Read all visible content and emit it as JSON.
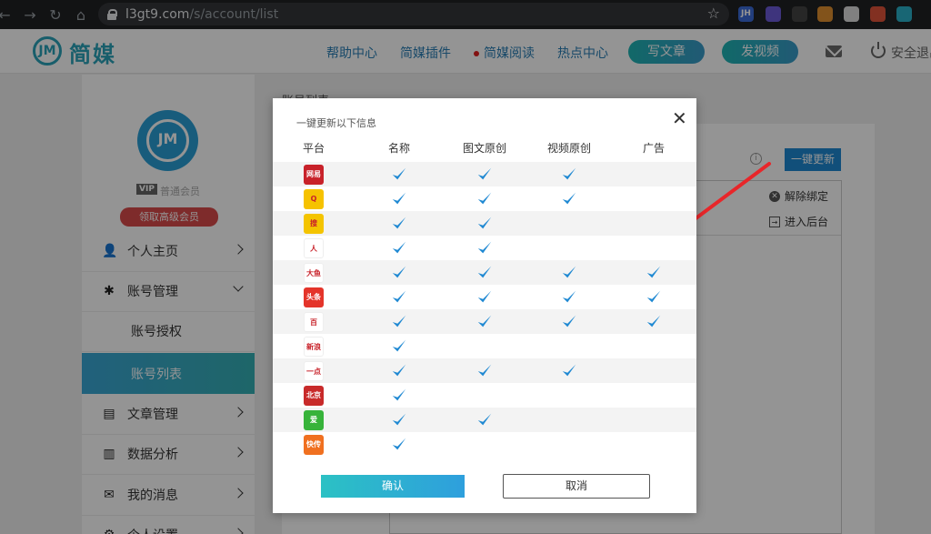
{
  "browser": {
    "url_host": "l3gt9.com",
    "url_path": "/s/account/list",
    "extensions": [
      {
        "label": "JH",
        "color": "#3b6bd8"
      },
      {
        "label": "",
        "color": "#6b5bd8"
      },
      {
        "label": "",
        "color": "#444"
      },
      {
        "label": "",
        "color": "#e09030"
      },
      {
        "label": "",
        "color": "#ddd"
      },
      {
        "label": "",
        "color": "#e0533a"
      },
      {
        "label": "",
        "color": "#2ab0c8"
      }
    ]
  },
  "app": {
    "logo_text": "简媒",
    "nav": [
      "帮助中心",
      "简媒插件",
      "简媒阅读",
      "热点中心"
    ],
    "write_article": "写文章",
    "post_video": "发视频",
    "logout": "安全退出"
  },
  "sidebar": {
    "vip_badge": "VIP",
    "member_level": "普通会员",
    "upgrade_label": "领取高级会员",
    "items": [
      {
        "label": "个人主页",
        "icon": "user-icon",
        "glyph": "👤"
      },
      {
        "label": "账号管理",
        "icon": "asterisk-icon",
        "glyph": "✱"
      },
      {
        "label": "账号授权",
        "icon": "",
        "glyph": ""
      },
      {
        "label": "账号列表",
        "icon": "",
        "glyph": ""
      },
      {
        "label": "文章管理",
        "icon": "document-icon",
        "glyph": "▤"
      },
      {
        "label": "数据分析",
        "icon": "bar-chart-icon",
        "glyph": "▥"
      },
      {
        "label": "我的消息",
        "icon": "message-icon",
        "glyph": "✉"
      },
      {
        "label": "个人设置",
        "icon": "gear-icon",
        "glyph": "⚙"
      }
    ]
  },
  "main": {
    "breadcrumb": "账号列表",
    "update_button": "一键更新",
    "unbind": "解除绑定",
    "enter_backend": "进入后台"
  },
  "modal": {
    "title": "一键更新以下信息",
    "columns": [
      "平台",
      "名称",
      "图文原创",
      "视频原创",
      "广告"
    ],
    "rows": [
      {
        "platform": "wangyi",
        "label": "网易",
        "color": "#c8222a",
        "checks": [
          true,
          true,
          true,
          false
        ]
      },
      {
        "platform": "qq",
        "label": "Q",
        "color": "#f6c200",
        "checks": [
          true,
          true,
          true,
          false
        ]
      },
      {
        "platform": "sohu",
        "label": "搜",
        "color": "#f4c400",
        "checks": [
          true,
          true,
          false,
          false
        ]
      },
      {
        "platform": "renmin",
        "label": "人",
        "color": "#ffffff",
        "checks": [
          true,
          true,
          false,
          false
        ]
      },
      {
        "platform": "dayu",
        "label": "大鱼号",
        "color": "#ffffff",
        "checks": [
          true,
          true,
          true,
          true
        ]
      },
      {
        "platform": "toutiao",
        "label": "头条",
        "color": "#e4342a",
        "checks": [
          true,
          true,
          true,
          true
        ]
      },
      {
        "platform": "baijia",
        "label": "百",
        "color": "#ffffff",
        "checks": [
          true,
          true,
          true,
          true
        ]
      },
      {
        "platform": "xinlang",
        "label": "新浪看点",
        "color": "#ffffff",
        "checks": [
          true,
          false,
          false,
          false
        ]
      },
      {
        "platform": "yidian",
        "label": "一点",
        "color": "#ffffff",
        "checks": [
          true,
          true,
          true,
          false
        ]
      },
      {
        "platform": "beijing",
        "label": "北京时间",
        "color": "#c82a2a",
        "checks": [
          true,
          false,
          false,
          false
        ]
      },
      {
        "platform": "iqiyi",
        "label": "爱",
        "color": "#37b33a",
        "checks": [
          true,
          true,
          false,
          false
        ]
      },
      {
        "platform": "kuaichuan",
        "label": "快传号",
        "color": "#f07020",
        "checks": [
          true,
          false,
          false,
          false
        ]
      }
    ],
    "confirm": "确认",
    "cancel": "取消"
  }
}
